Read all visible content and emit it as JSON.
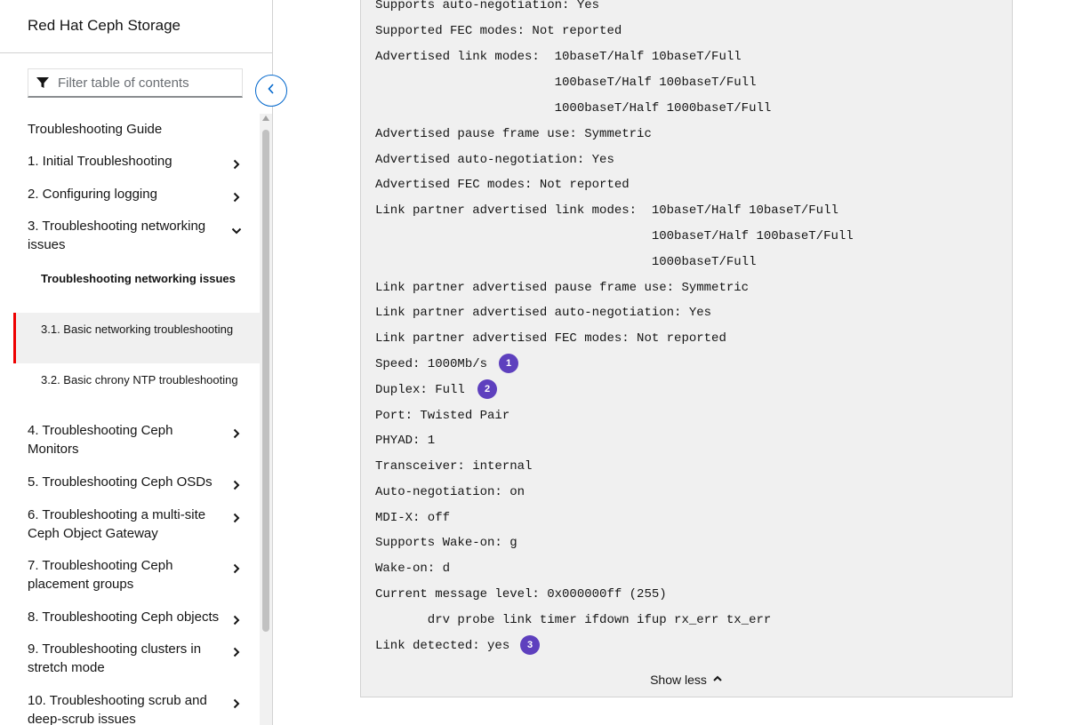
{
  "sidebar": {
    "title": "Red Hat Ceph Storage",
    "filter_placeholder": "Filter table of contents",
    "items": [
      {
        "label": "Troubleshooting Guide",
        "chevron": "none"
      },
      {
        "label": "1. Initial Troubleshooting",
        "chevron": "right"
      },
      {
        "label": "2. Configuring logging",
        "chevron": "right"
      },
      {
        "label": "3. Troubleshooting networking issues",
        "chevron": "down"
      },
      {
        "label": "4. Troubleshooting Ceph Monitors",
        "chevron": "right"
      },
      {
        "label": "5. Troubleshooting Ceph OSDs",
        "chevron": "right"
      },
      {
        "label": "6. Troubleshooting a multi-site Ceph Object Gateway",
        "chevron": "right"
      },
      {
        "label": "7. Troubleshooting Ceph placement groups",
        "chevron": "right"
      },
      {
        "label": "8. Troubleshooting Ceph objects",
        "chevron": "right"
      },
      {
        "label": "9. Troubleshooting clusters in stretch mode",
        "chevron": "right"
      },
      {
        "label": "10. Troubleshooting scrub and deep-scrub issues",
        "chevron": "right"
      }
    ],
    "subitems": [
      {
        "label": "Troubleshooting networking issues",
        "bold": true
      },
      {
        "label": "3.1. Basic networking troubleshooting",
        "active": true
      },
      {
        "label": "3.2. Basic chrony NTP troubleshooting"
      }
    ]
  },
  "code": {
    "lines": [
      "Supports auto-negotiation: Yes",
      "Supported FEC modes: Not reported",
      "Advertised link modes:  10baseT/Half 10baseT/Full",
      "                        100baseT/Half 100baseT/Full",
      "                        1000baseT/Half 1000baseT/Full",
      "Advertised pause frame use: Symmetric",
      "Advertised auto-negotiation: Yes",
      "Advertised FEC modes: Not reported",
      "Link partner advertised link modes:  10baseT/Half 10baseT/Full",
      "                                     100baseT/Half 100baseT/Full",
      "                                     1000baseT/Full",
      "Link partner advertised pause frame use: Symmetric",
      "Link partner advertised auto-negotiation: Yes",
      "Link partner advertised FEC modes: Not reported",
      "Speed: 1000Mb/s",
      "Duplex: Full",
      "Port: Twisted Pair",
      "PHYAD: 1",
      "Transceiver: internal",
      "Auto-negotiation: on",
      "MDI-X: off",
      "Supports Wake-on: g",
      "Wake-on: d",
      "Current message level: 0x000000ff (255)",
      "       drv probe link timer ifdown ifup rx_err tx_err",
      "Link detected: yes"
    ],
    "callouts": [
      "1",
      "2",
      "3"
    ],
    "show_less_label": "Show less"
  },
  "colors": {
    "callout": "#5e40be",
    "active_marker": "#ee0000",
    "link_blue": "#0066cc"
  }
}
